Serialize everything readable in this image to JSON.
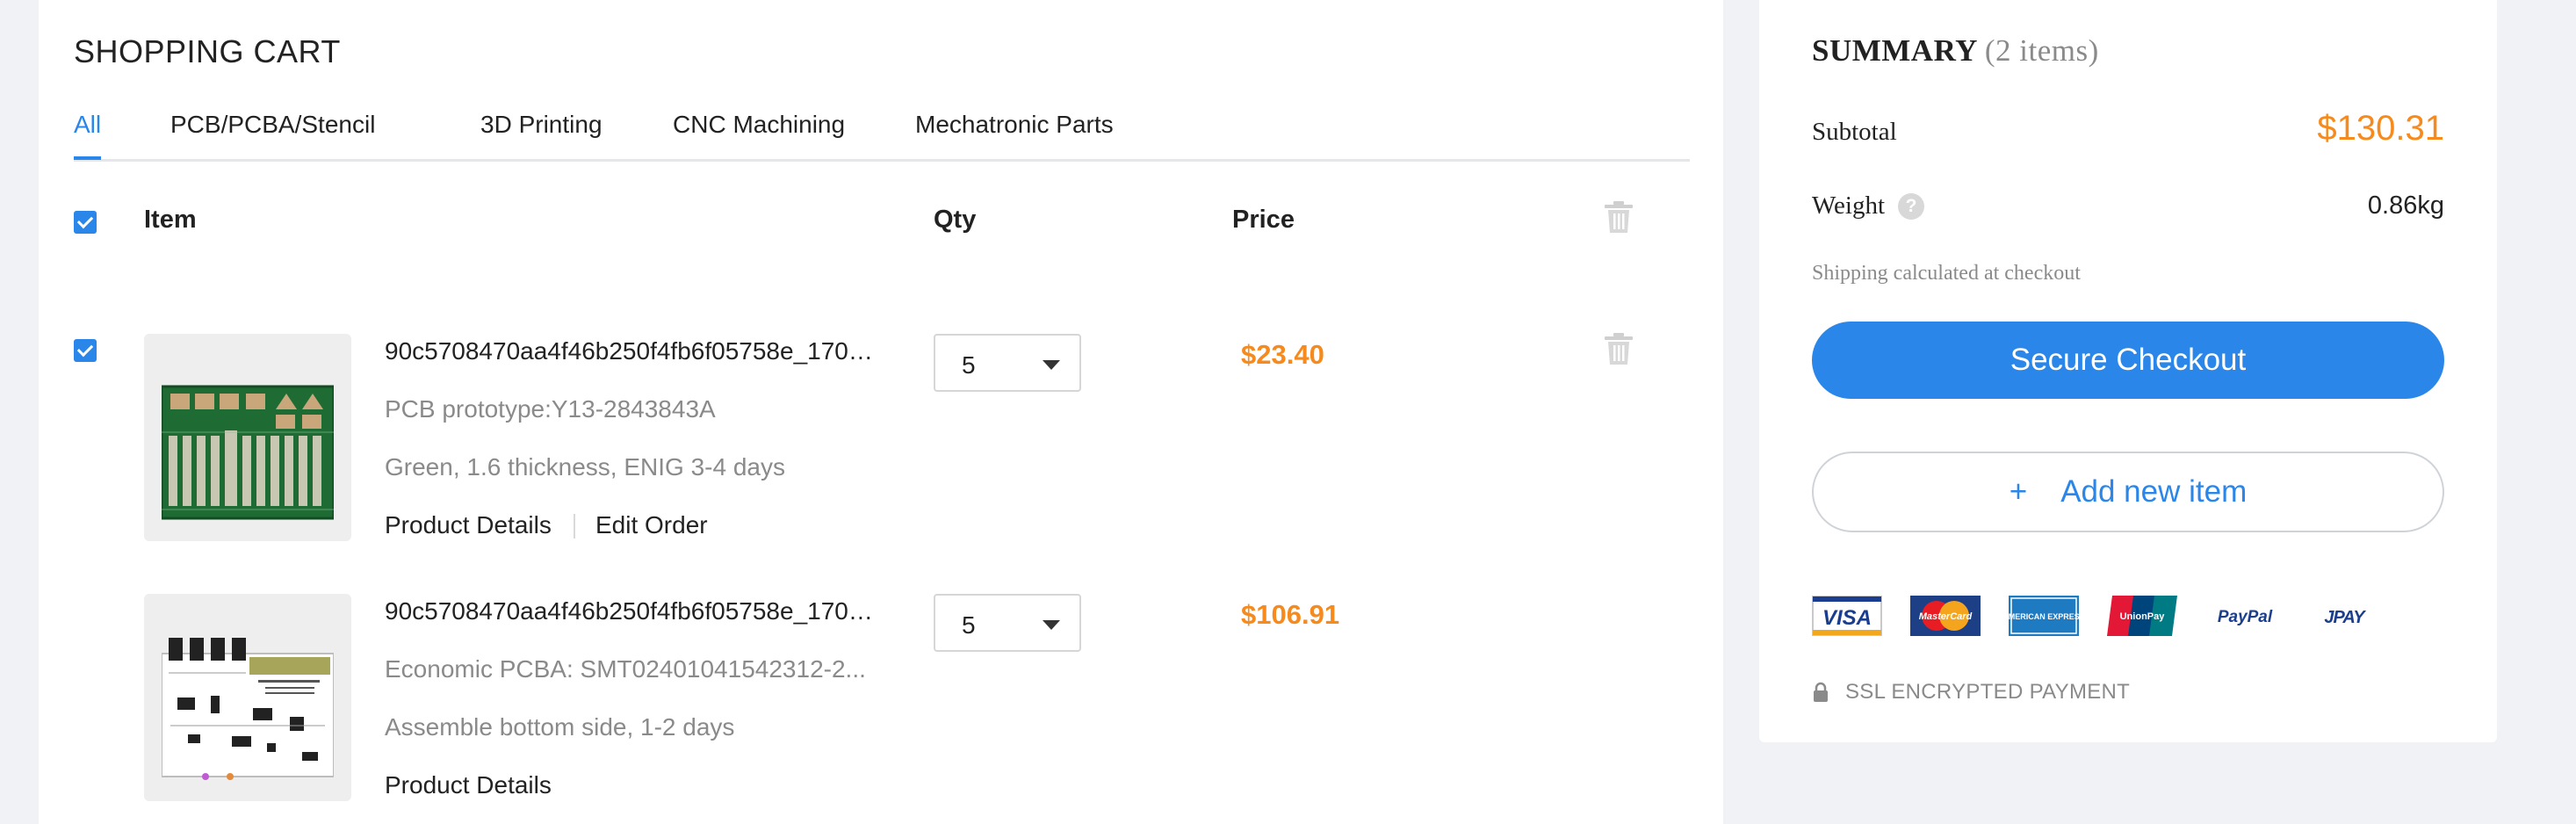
{
  "cart": {
    "title": "SHOPPING CART",
    "tabs": [
      {
        "label": "All",
        "active": true
      },
      {
        "label": "PCB/PCBA/Stencil",
        "active": false
      },
      {
        "label": "3D Printing",
        "active": false
      },
      {
        "label": "CNC Machining",
        "active": false
      },
      {
        "label": "Mechatronic Parts",
        "active": false
      }
    ],
    "columns": {
      "item": "Item",
      "qty": "Qty",
      "price": "Price"
    },
    "items": [
      {
        "name": "90c5708470aa4f46b250f4fb6f05758e_1705...",
        "detail1": "PCB prototype:Y13-2843843A",
        "detail2": "Green, 1.6 thickness, ENIG 3-4 days",
        "link_details": "Product Details",
        "link_edit": "Edit Order",
        "qty": "5",
        "price": "$23.40",
        "checked": true,
        "thumb_icon": "green-pcb-board-icon"
      },
      {
        "name": "90c5708470aa4f46b250f4fb6f05758e_1705...",
        "detail1": "Economic PCBA: SMT02401041542312-2...",
        "detail2": "Assemble bottom side, 1-2 days",
        "link_details": "Product Details",
        "qty": "5",
        "price": "$106.91",
        "thumb_icon": "pcba-assembly-drawing-icon"
      }
    ]
  },
  "summary": {
    "title": "SUMMARY",
    "count": "(2 items)",
    "subtotal_label": "Subtotal",
    "subtotal_value": "$130.31",
    "weight_label": "Weight",
    "weight_help": "?",
    "weight_value": "0.86kg",
    "shipping_note": "Shipping calculated at checkout",
    "checkout_label": "Secure Checkout",
    "add_plus": "+",
    "add_label": "Add new item",
    "payment_methods": [
      "VISA",
      "MasterCard",
      "AMERICAN EXPRESS",
      "UnionPay",
      "PayPal",
      "JPAY"
    ],
    "ssl_text": "SSL ENCRYPTED PAYMENT"
  },
  "colors": {
    "accent": "#2a86e8",
    "price": "#f68a1d",
    "muted": "#8a8a8a",
    "background": "#f0f2f5"
  }
}
